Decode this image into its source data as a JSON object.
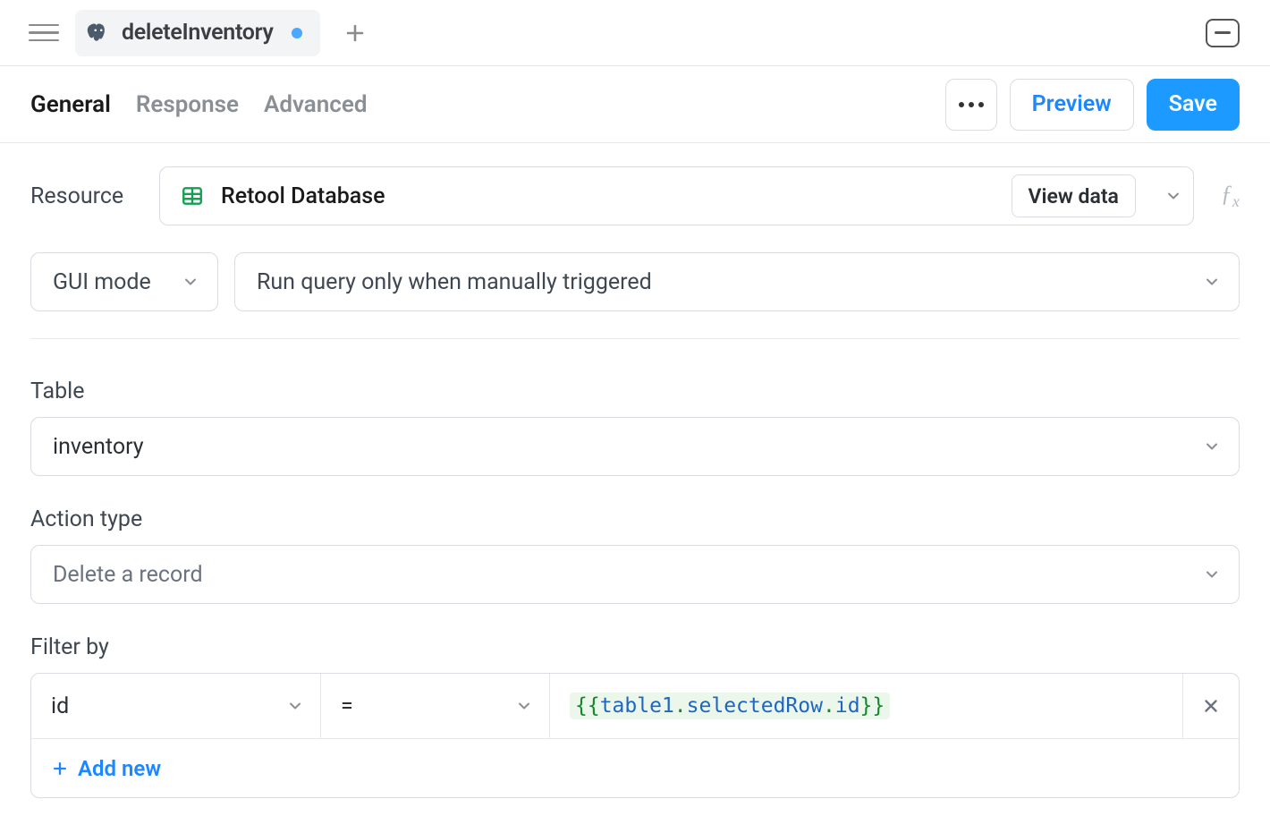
{
  "topbar": {
    "tab_title": "deleteInventory",
    "dirty": true
  },
  "subnav": {
    "tabs": [
      "General",
      "Response",
      "Advanced"
    ],
    "active_index": 0,
    "preview_label": "Preview",
    "save_label": "Save"
  },
  "resource": {
    "label": "Resource",
    "name": "Retool Database",
    "view_data_label": "View data",
    "fx_label": "ƒx"
  },
  "mode": {
    "mode_label": "GUI mode",
    "trigger_label": "Run query only when manually triggered"
  },
  "table": {
    "label": "Table",
    "value": "inventory"
  },
  "action": {
    "label": "Action type",
    "value": "Delete a record"
  },
  "filter": {
    "label": "Filter by",
    "column": "id",
    "operator": "=",
    "value_open": "{{",
    "value_obj": "table1",
    "value_dot1": ".",
    "value_prop1": "selectedRow",
    "value_dot2": ".",
    "value_prop2": "id",
    "value_close": "}}",
    "add_label": "Add new"
  }
}
